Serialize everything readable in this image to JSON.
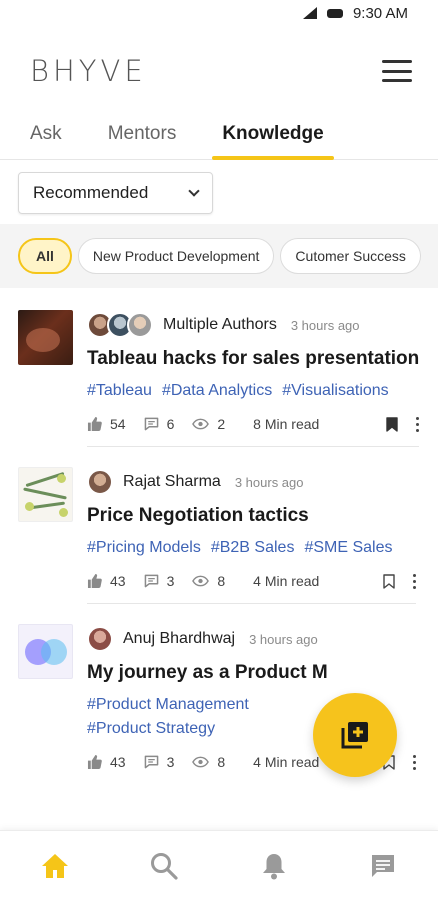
{
  "status_bar": {
    "time": "9:30 AM"
  },
  "app": {
    "logo": "HYVE",
    "logo_mark": "B"
  },
  "tabs": [
    {
      "label": "Ask"
    },
    {
      "label": "Mentors"
    },
    {
      "label": "Knowledge",
      "active": true
    }
  ],
  "filter": {
    "selected": "Recommended"
  },
  "chips": [
    {
      "label": "All",
      "active": true
    },
    {
      "label": "New Product Development"
    },
    {
      "label": "Cutomer Success"
    }
  ],
  "posts": [
    {
      "author": "Multiple Authors",
      "time": "3 hours ago",
      "title": "Tableau hacks for sales presentation",
      "tags": [
        "#Tableau",
        "#Data Analytics",
        "#Visualisations"
      ],
      "likes": "54",
      "comments": "6",
      "views": "2",
      "read_time": "8 Min read",
      "bookmarked": true
    },
    {
      "author": "Rajat Sharma",
      "time": "3 hours ago",
      "title": "Price Negotiation tactics",
      "tags": [
        "#Pricing Models",
        "#B2B Sales",
        "#SME Sales"
      ],
      "likes": "43",
      "comments": "3",
      "views": "8",
      "read_time": "4 Min read",
      "bookmarked": false
    },
    {
      "author": "Anuj Bhardhwaj",
      "time": "3 hours ago",
      "title": "My journey as a Product M",
      "tags": [
        "#Product Management",
        "#Product Strategy"
      ],
      "likes": "43",
      "comments": "3",
      "views": "8",
      "read_time": "4 Min read",
      "bookmarked": false
    }
  ],
  "colors": {
    "accent": "#f5c518",
    "tag": "#3e63b5",
    "fab": "#f6c31c"
  },
  "bottom_nav": [
    {
      "icon": "home-icon",
      "active": true
    },
    {
      "icon": "search-icon"
    },
    {
      "icon": "bell-icon"
    },
    {
      "icon": "chat-icon"
    }
  ],
  "fab": {
    "icon": "add-post-icon"
  }
}
